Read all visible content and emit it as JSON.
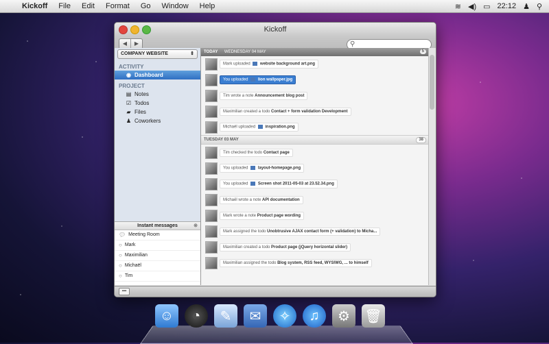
{
  "menubar": {
    "app_name": "Kickoff",
    "menus": [
      "File",
      "Edit",
      "Format",
      "Go",
      "Window",
      "Help"
    ],
    "clock": "22:12"
  },
  "window": {
    "title": "Kickoff",
    "search": {
      "placeholder": "",
      "value": ""
    }
  },
  "sidebar": {
    "project_select": "COMPANY WEBSITE",
    "activity_heading": "ACTIVITY",
    "activity_items": [
      {
        "label": "Dashboard",
        "icon": "dashboard-icon",
        "active": true
      }
    ],
    "project_heading": "PROJECT",
    "project_items": [
      {
        "label": "Notes",
        "icon": "notes-icon"
      },
      {
        "label": "Todos",
        "icon": "checkbox-icon"
      },
      {
        "label": "Files",
        "icon": "folder-icon"
      },
      {
        "label": "Coworkers",
        "icon": "person-icon"
      }
    ]
  },
  "instant_messages": {
    "title": "Instant messages",
    "rows": [
      "Meeting Room",
      "Mark",
      "Maximilian",
      "Michaël",
      "Tim"
    ]
  },
  "feed": {
    "today": {
      "label": "TODAY",
      "date": "WEDNESDAY 04 MAY",
      "count": "5",
      "items": [
        {
          "prefix": "Mark uploaded",
          "subject": "website background art.png",
          "file_icon": true
        },
        {
          "prefix": "You uploaded",
          "subject": "lion wallpaper.jpg",
          "file_icon": true,
          "active": true
        },
        {
          "prefix": "Tim wrote a note",
          "subject": "Announcement blog post"
        },
        {
          "prefix": "Maximilian created a todo",
          "subject": "Contact + form validation Development"
        },
        {
          "prefix": "Michaël uploaded",
          "subject": "inspiration.png",
          "file_icon": true
        }
      ]
    },
    "yesterday": {
      "label": "TUESDAY 03 MAY",
      "count": "38",
      "items": [
        {
          "prefix": "Tim checked the todo",
          "subject": "Contact page"
        },
        {
          "prefix": "You uploaded",
          "subject": "layout-homepage.png",
          "file_icon": true
        },
        {
          "prefix": "You uploaded",
          "subject": "Screen shot 2011-05-03 at 23.52.34.png",
          "file_icon": true
        },
        {
          "prefix": "Michaël wrote a note",
          "subject": "API documentation"
        },
        {
          "prefix": "Mark wrote a note",
          "subject": "Product page wording"
        },
        {
          "prefix": "Mark assigned the todo",
          "subject": "Unobtrusive AJAX contact form (+ validation) to Micha..."
        },
        {
          "prefix": "Maximilian created a todo",
          "subject": "Product page (jQuery horizontal slider)"
        },
        {
          "prefix": "Maximilian assigned the todo",
          "subject": "Blog system, RSS feed, WYSIWG, ... to himself"
        }
      ]
    }
  },
  "dock": [
    "Finder",
    "Dashboard",
    "Address Book",
    "Mail",
    "Safari",
    "iTunes",
    "System Preferences",
    "Trash"
  ]
}
